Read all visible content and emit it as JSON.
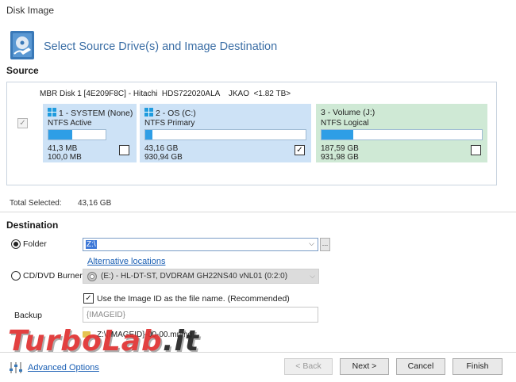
{
  "window": {
    "title": "Disk Image"
  },
  "header": {
    "title": "Select Source Drive(s) and Image Destination",
    "icon": "disk-image-icon"
  },
  "source": {
    "label": "Source",
    "disk_info": "MBR Disk 1 [4E209F8C] - Hitachi  HDS722020ALA    JKAO  <1.82 TB>",
    "partitions": [
      {
        "title": "1 - SYSTEM (None)",
        "type": "NTFS Active",
        "used": "41,3 MB",
        "total": "100,0 MB",
        "fill": 0.41,
        "checked": false,
        "checkmark": "",
        "color": "#cde2f6",
        "windows_logo": true
      },
      {
        "title": "2 - OS (C:)",
        "type": "NTFS Primary",
        "used": "43,16 GB",
        "total": "930,94 GB",
        "fill": 0.046,
        "checked": true,
        "checkmark": "✓",
        "color": "#cde2f6",
        "windows_logo": true
      },
      {
        "title": "3 - Volume (J:)",
        "type": "NTFS Logical",
        "used": "187,59 GB",
        "total": "931,98 GB",
        "fill": 0.2,
        "checked": false,
        "checkmark": "",
        "color": "#cfe9d5",
        "windows_logo": false
      }
    ],
    "total_selected_label": "Total Selected:",
    "total_selected_value": "43,16 GB"
  },
  "destination": {
    "label": "Destination",
    "folder_label": "Folder",
    "folder_value": "Z:\\",
    "browse_label": "...",
    "alternative_locations": "Alternative locations",
    "cd_label": "CD/DVD Burner",
    "cd_value": "(E:) - HL-DT-ST, DVDRAM GH22NS40  vNL01 (0:2:0)",
    "use_image_id_label": "Use the Image ID as the file name.  (Recommended)",
    "backup_label": "Backup",
    "backup_placeholder": "{IMAGEID}",
    "path_preview": "Z:\\{IMAGEID}-00-00.mrimg"
  },
  "footer": {
    "advanced_options": "Advanced Options",
    "back": "< Back",
    "next": "Next >",
    "cancel": "Cancel",
    "finish": "Finish"
  },
  "watermark": {
    "text_main": "TurboLab",
    "text_dot": ".it"
  }
}
